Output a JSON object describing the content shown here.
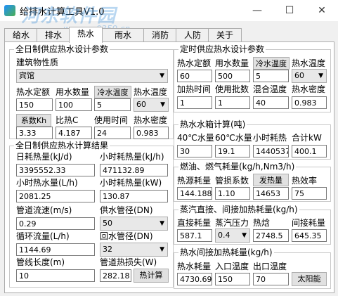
{
  "window": {
    "title": "给排水计算工具V1.0",
    "min_glyph": "—",
    "max_glyph": "☐",
    "close_glyph": "✕"
  },
  "watermark": {
    "text": "河东软件园",
    "url": "www.pc0359.cn"
  },
  "tabs": [
    "给水",
    "排水",
    "热水",
    "雨水",
    "消防",
    "人防",
    "关于"
  ],
  "active_tab": "热水",
  "full_supply": {
    "title": "全日制供应热水设计参数",
    "building_label": "建筑物性质",
    "building_value": "宾馆",
    "quota_label": "热水定额",
    "quota_value": "150",
    "count_label": "用水数量",
    "count_value": "100",
    "cold_temp_button": "冷水温度",
    "cold_temp_value": "5",
    "hot_temp_label": "热水温度",
    "hot_temp_value": "60",
    "kh_button": "系数Kh",
    "kh_value": "3.33",
    "specific_heat_label": "比热C",
    "specific_heat_value": "4.187",
    "use_time_label": "使用时间",
    "use_time_value": "24",
    "density_label": "热水密度",
    "density_value": "0.983"
  },
  "full_result": {
    "title": "全日制供应热水计算结果",
    "daily_heat_label": "日耗热量(kJ/d)",
    "daily_heat_value": "3395552.33",
    "hour_heat_kj_label": "小时耗热量(kJ/h)",
    "hour_heat_kj_value": "471132.89",
    "hour_water_label": "小时热水量(L/h)",
    "hour_water_value": "2081.25",
    "hour_heat_kw_label": "小时耗热量(kW)",
    "hour_heat_kw_value": "130.87",
    "velocity_label": "管道流速(m/s)",
    "velocity_value": "0.29",
    "supply_dn_label": "供水管径(DN)",
    "supply_dn_value": "50",
    "circ_flow_label": "循环流量(L/h)",
    "circ_flow_value": "1144.69",
    "return_dn_label": "回水管径(DN)",
    "return_dn_value": "32",
    "pipe_length_label": "管线长度(m)",
    "pipe_length_value": "10",
    "heat_loss_label": "管道热损失(W)",
    "heat_loss_value": "282.18",
    "calc_button": "热计算"
  },
  "timed_supply": {
    "title": "定时供应热水设计参数",
    "quota_label": "热水定额",
    "quota_value": "60",
    "count_label": "用水数量",
    "count_value": "500",
    "cold_temp_button": "冷水温度",
    "cold_temp_value": "5",
    "hot_temp_label": "热水温度",
    "hot_temp_value": "60",
    "heat_time_label": "加热时间",
    "heat_time_value": "1",
    "batches_label": "使用批数",
    "batches_value": "1",
    "mix_temp_label": "混合温度",
    "mix_temp_value": "40",
    "density_label": "热水密度",
    "density_value": "0.983"
  },
  "tank": {
    "title": "热水水箱计算(吨)",
    "c40_label": "40℃水量",
    "c40_value": "30",
    "c60_label": "60℃水量",
    "c60_value": "19.1",
    "hour_heat_label": "小时耗热",
    "hour_heat_value": "1440537.",
    "total_kw_label": "合计kW",
    "total_kw_value": "400.1"
  },
  "fuel": {
    "title": "燃油、燃气耗量(kg/h,Nm3/h)",
    "heat_source_label": "热源耗量",
    "heat_source_value": "144.188",
    "loss_factor_label": "管损系数",
    "loss_factor_value": "1.10",
    "calorific_button": "发热量",
    "calorific_value": "14653",
    "efficiency_label": "热效率",
    "efficiency_value": "75"
  },
  "steam": {
    "title": "蒸汽直接、间接加热耗量(kg/h)",
    "direct_label": "直接耗量",
    "direct_value": "587.1",
    "pressure_label": "蒸汽压力",
    "pressure_value": "0.4",
    "enthalpy_label": "热焓",
    "enthalpy_value": "2748.5",
    "indirect_label": "间接耗量",
    "indirect_value": "645.35"
  },
  "indirect_water": {
    "title": "热水间接加热耗量(kg/h)",
    "consumption_label": "热水耗量",
    "consumption_value": "4730.69",
    "inlet_label": "入口温度",
    "inlet_value": "150",
    "outlet_label": "出口温度",
    "outlet_value": "70",
    "solar_button": "太阳能"
  }
}
